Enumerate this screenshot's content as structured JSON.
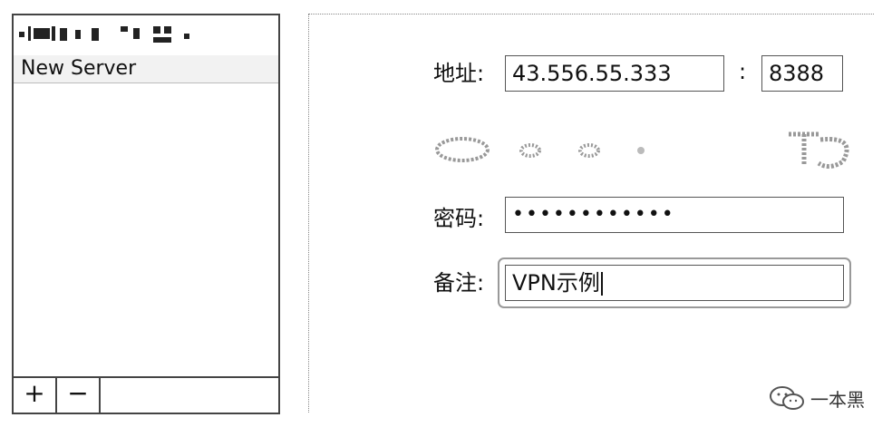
{
  "sidebar": {
    "items": [
      {
        "label": "New Server"
      }
    ],
    "add_label": "+",
    "remove_label": "−"
  },
  "form": {
    "address_label": "地址:",
    "address_value": "43.556.55.333",
    "port_separator": ":",
    "port_value": "8388",
    "password_label": "密码:",
    "password_value": "••••••••••••",
    "remark_label": "备注:",
    "remark_value": "VPN示例"
  },
  "watermark": {
    "text": "一本黑",
    "icon": "wechat-icon"
  }
}
